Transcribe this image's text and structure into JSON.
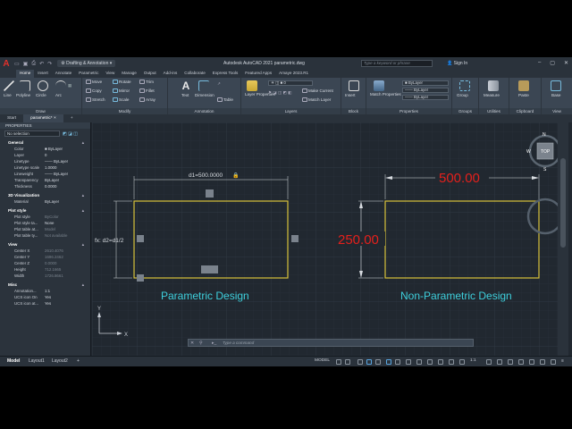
{
  "app": {
    "logo": "A",
    "workspace": "Drafting & Annotation",
    "title": "Autodesk AutoCAD 2021   parametric.dwg",
    "search_placeholder": "Type a keyword or phrase",
    "signin": "Sign In"
  },
  "ribbon_tabs": [
    "Home",
    "Insert",
    "Annotate",
    "Parametric",
    "View",
    "Manage",
    "Output",
    "Add-ins",
    "Collaborate",
    "Express Tools",
    "Featured Apps",
    "Amaye 2023.R1"
  ],
  "ribbon": {
    "draw": {
      "label": "Draw",
      "line": "Line",
      "polyline": "Polyline",
      "circle": "Circle",
      "arc": "Arc"
    },
    "modify": {
      "label": "Modify",
      "move": "Move",
      "rotate": "Rotate",
      "trim": "Trim",
      "copy": "Copy",
      "mirror": "Mirror",
      "fillet": "Fillet",
      "stretch": "Stretch",
      "scale": "Scale",
      "array": "Array"
    },
    "annotation": {
      "label": "Annotation",
      "text": "Text",
      "dimension": "Dimension",
      "table": "Table"
    },
    "layers": {
      "label": "Layers",
      "layer_properties": "Layer Properties",
      "current_layer": "0",
      "make_current": "Make Current",
      "match_layer": "Match Layer"
    },
    "block": {
      "label": "Block",
      "insert": "Insert"
    },
    "properties": {
      "label": "Properties",
      "match_properties": "Match Properties",
      "color": "ByLayer",
      "linetype": "ByLayer",
      "lineweight": "ByLayer"
    },
    "groups": {
      "label": "Groups",
      "group": "Group"
    },
    "utilities": {
      "label": "Utilities",
      "measure": "Measure"
    },
    "clipboard": {
      "label": "Clipboard",
      "paste": "Paste"
    },
    "view": {
      "label": "View",
      "base": "Base"
    }
  },
  "doc_tabs": [
    "Start",
    "parametric*"
  ],
  "properties": {
    "header": "PROPERTIES",
    "selection": "No selection",
    "general": {
      "title": "General",
      "rows": [
        {
          "k": "Color",
          "v": "ByLayer"
        },
        {
          "k": "Layer",
          "v": "0"
        },
        {
          "k": "Linetype",
          "v": "—— ByLayer"
        },
        {
          "k": "Linetype scale",
          "v": "1.0000"
        },
        {
          "k": "Lineweight",
          "v": "—— ByLayer"
        },
        {
          "k": "Transparency",
          "v": "ByLayer"
        },
        {
          "k": "Thickness",
          "v": "0.0000"
        }
      ]
    },
    "visualization": {
      "title": "3D Visualization",
      "rows": [
        {
          "k": "Material",
          "v": "ByLayer"
        }
      ]
    },
    "plotstyle": {
      "title": "Plot style",
      "rows": [
        {
          "k": "Plot style",
          "v": "ByColor"
        },
        {
          "k": "Plot style ta...",
          "v": "None"
        },
        {
          "k": "Plot table at...",
          "v": "Model"
        },
        {
          "k": "Plot table ty...",
          "v": "Not available"
        }
      ]
    },
    "view": {
      "title": "View",
      "rows": [
        {
          "k": "Center X",
          "v": "2610.4076"
        },
        {
          "k": "Center Y",
          "v": "1696.2462"
        },
        {
          "k": "Center Z",
          "v": "0.0000"
        },
        {
          "k": "Height",
          "v": "712.1665"
        },
        {
          "k": "Width",
          "v": "1726.8661"
        }
      ]
    },
    "misc": {
      "title": "Misc",
      "rows": [
        {
          "k": "Annotation...",
          "v": "1:1"
        },
        {
          "k": "UCS icon On",
          "v": "Yes"
        },
        {
          "k": "UCS icon at...",
          "v": "Yes"
        }
      ]
    }
  },
  "drawing": {
    "param_dim": "d1=500.0000",
    "param_vdim": "fx: d2=d1/2",
    "param_caption": "Parametric Design",
    "nonparam_width": "500.00",
    "nonparam_height": "250.00",
    "nonparam_caption": "Non-Parametric Design",
    "viewcube": {
      "top": "TOP",
      "n": "N",
      "s": "S",
      "e": "E",
      "w": "W"
    },
    "ucs_x": "X",
    "ucs_y": "Y"
  },
  "command": {
    "placeholder": "Type a command"
  },
  "status": {
    "model_tab": "Model",
    "layouts": [
      "Layout1",
      "Layout2"
    ],
    "add": "+",
    "mode": "MODEL",
    "scale": "1:1"
  },
  "colors": {
    "rect": "#d8c23a",
    "dim_red": "#e4201c",
    "caption": "#3ecfdc",
    "dim_white": "#d9dde2",
    "bg": "#212830"
  }
}
